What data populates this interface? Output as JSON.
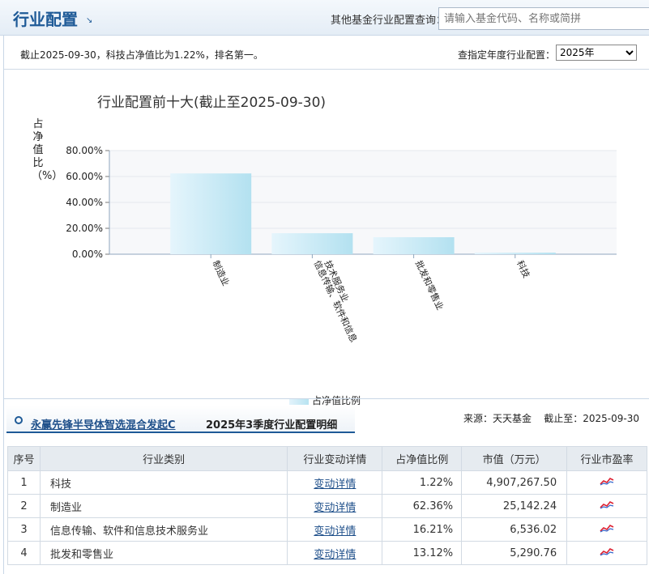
{
  "header": {
    "title": "行业配置",
    "query_label": "其他基金行业配置查询：",
    "query_placeholder": "请输入基金代码、名称或简拼"
  },
  "info": {
    "summary": "截止2025-09-30，科技占净值比为1.22%，排名第一。",
    "year_label": "查指定年度行业配置：",
    "year_value": "2025年"
  },
  "chart_data": {
    "type": "bar",
    "title": "行业配置前十大(截止至2025-09-30)",
    "ylabel": "占净值比（%）",
    "xlabel": "",
    "categories": [
      "制造业",
      "信息传输、软件和信息技术服务业",
      "批发和零售业",
      "科技"
    ],
    "series": [
      {
        "name": "占净值比例",
        "values": [
          62.36,
          16.21,
          13.12,
          1.22
        ]
      }
    ],
    "ylim": [
      0,
      80
    ],
    "yticks": [
      "80.00%",
      "60.00%",
      "40.00%",
      "20.00%",
      "0.00%"
    ],
    "grid": true,
    "legend": "bottom"
  },
  "detail": {
    "fund_name": "永赢先锋半导体智选混合发起C",
    "title": "2025年3季度行业配置明细",
    "source": "来源：天天基金    截止至：2025-09-30",
    "columns": [
      "序号",
      "行业类别",
      "行业变动详情",
      "占净值比例",
      "市值（万元）",
      "行业市盈率"
    ],
    "rows": [
      {
        "no": "1",
        "category": "科技",
        "change": "变动详情",
        "pct": "1.22%",
        "mv": "4,907,267.50"
      },
      {
        "no": "2",
        "category": "制造业",
        "change": "变动详情",
        "pct": "62.36%",
        "mv": "25,142.24"
      },
      {
        "no": "3",
        "category": "信息传输、软件和信息技术服务业",
        "change": "变动详情",
        "pct": "16.21%",
        "mv": "6,536.02"
      },
      {
        "no": "4",
        "category": "批发和零售业",
        "change": "变动详情",
        "pct": "13.12%",
        "mv": "5,290.76"
      }
    ]
  }
}
